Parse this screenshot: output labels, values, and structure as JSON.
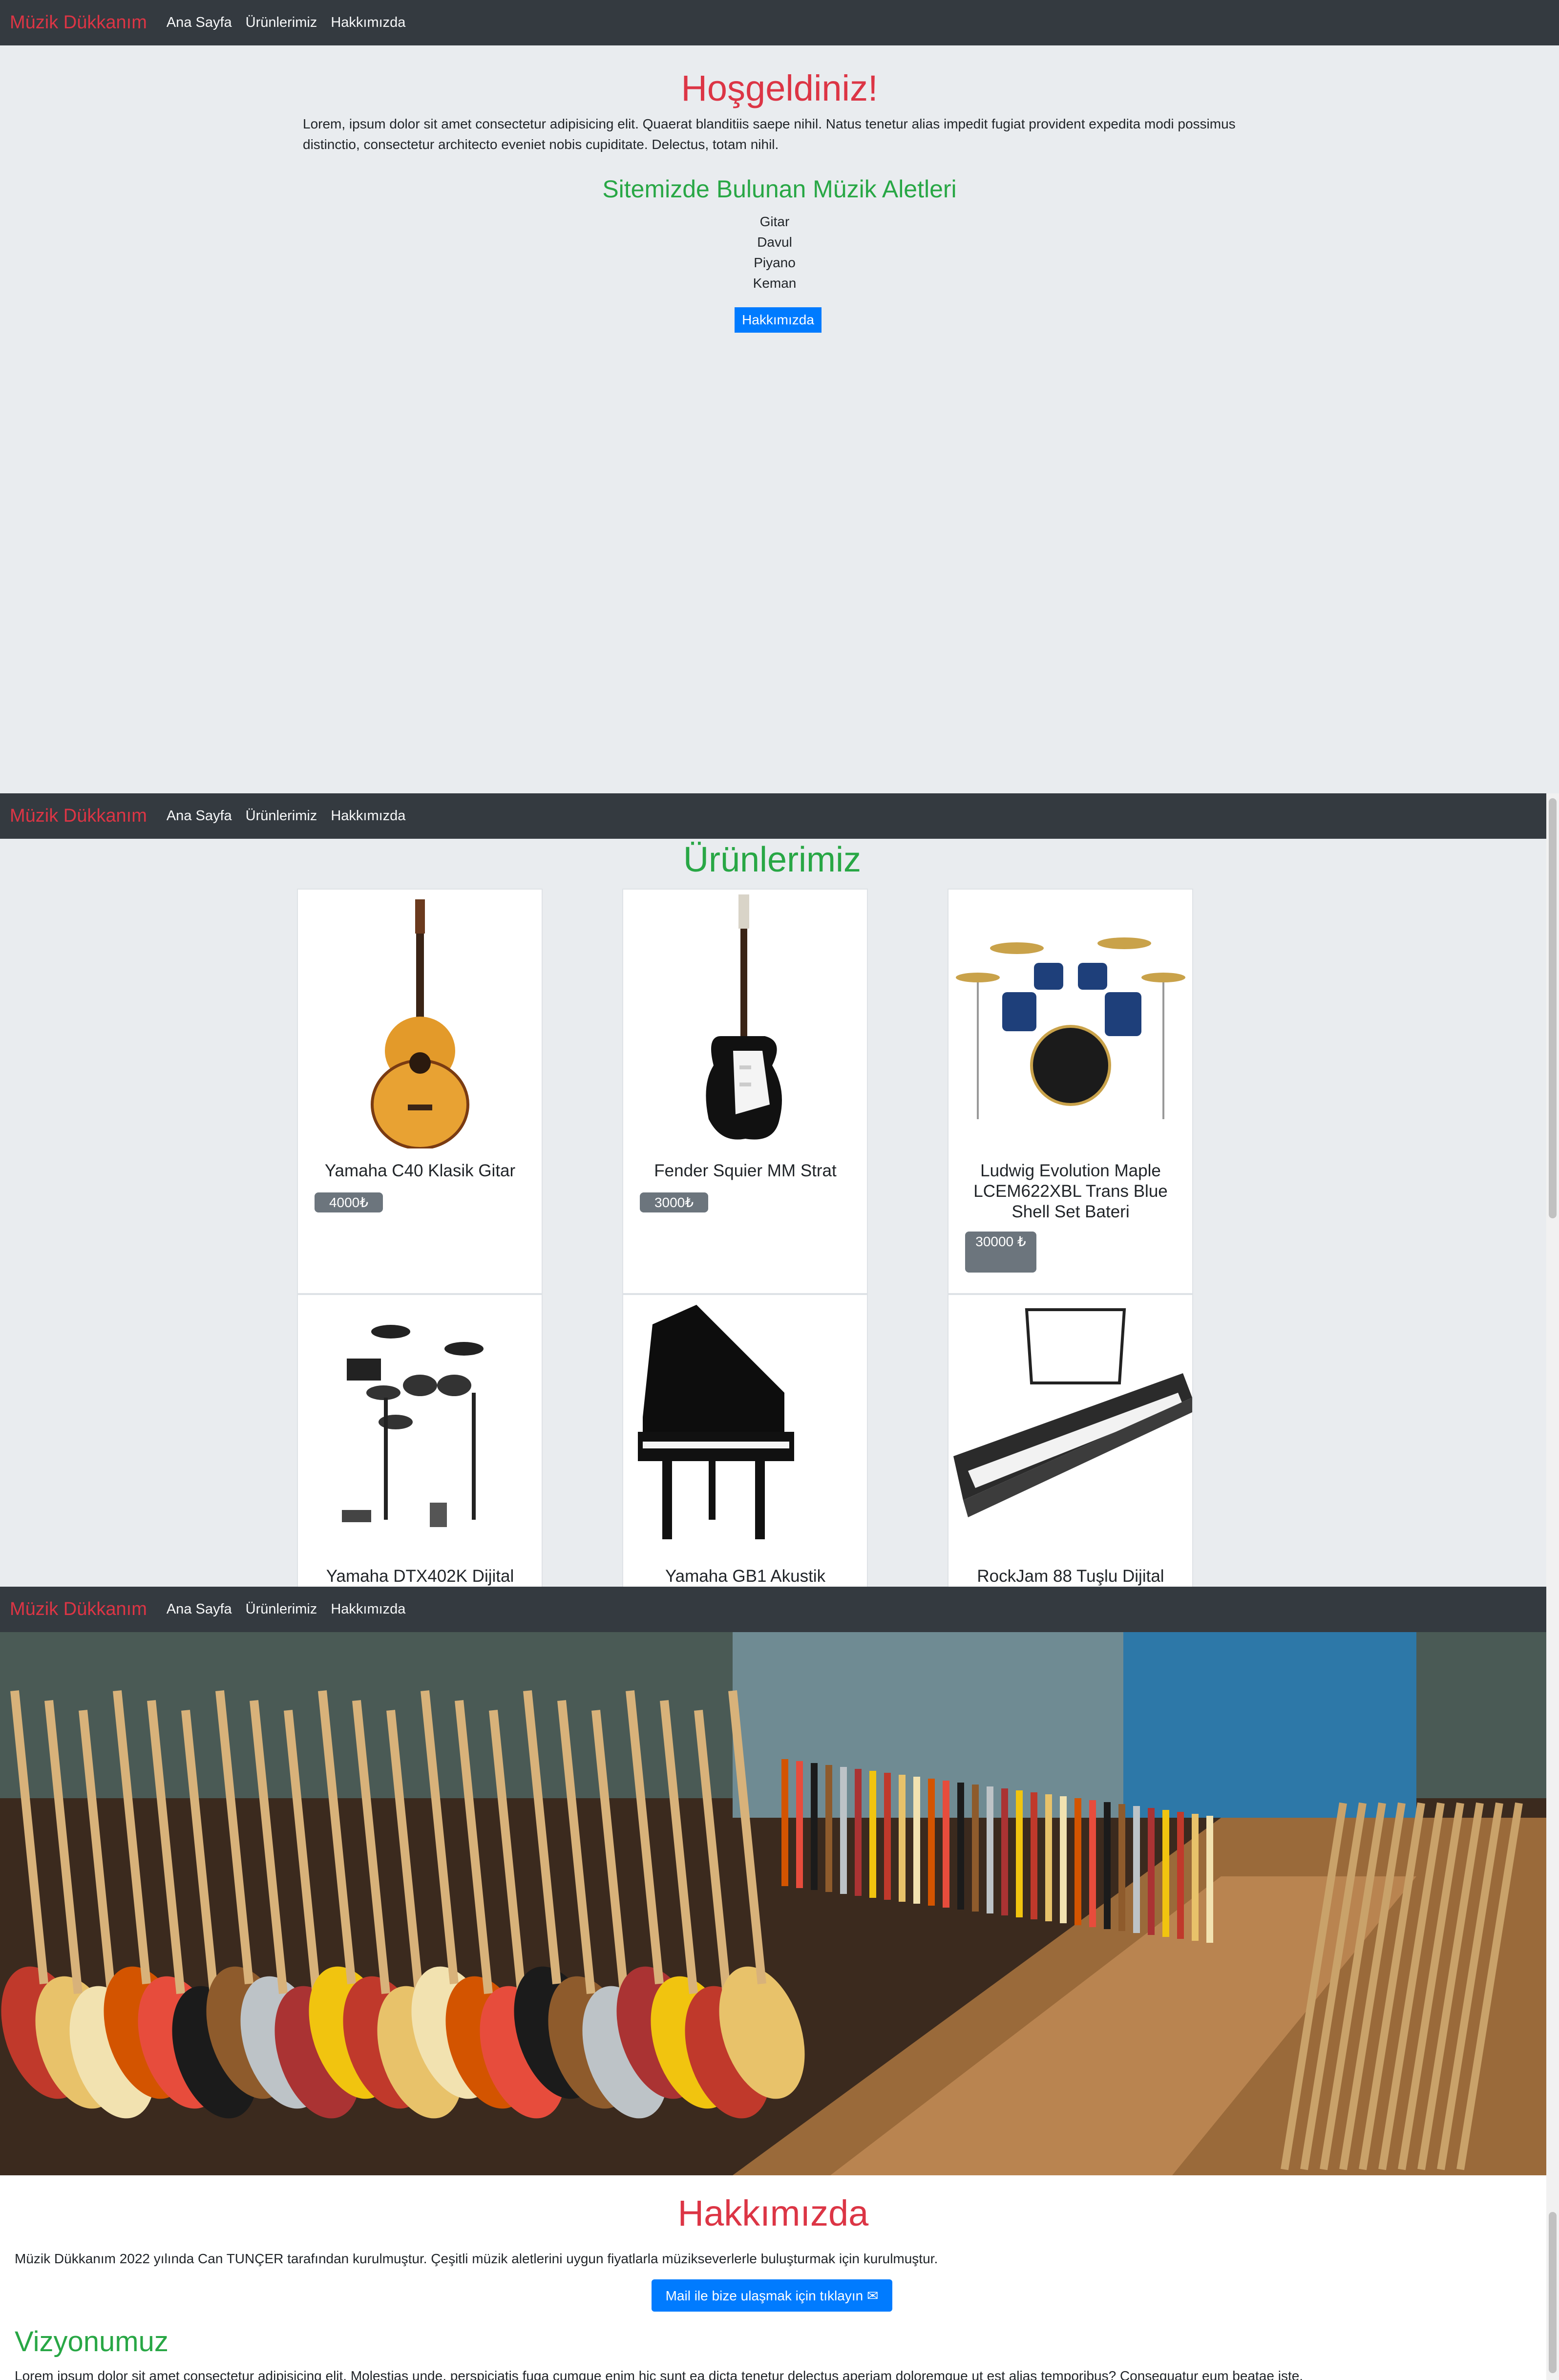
{
  "nav": {
    "brand": "Müzik Dükkanım",
    "links": [
      "Ana Sayfa",
      "Ürünlerimiz",
      "Hakkımızda"
    ]
  },
  "home": {
    "title": "Hoşgeldiniz!",
    "lead": "Lorem, ipsum dolor sit amet consectetur adipisicing elit. Quaerat blanditiis saepe nihil. Natus tenetur alias impedit fugiat provident expedita modi possimus distinctio, consectetur architecto eveniet nobis cupiditate. Delectus, totam nihil.",
    "subtitle": "Sitemizde Bulunan Müzik Aletleri",
    "instruments": [
      "Gitar",
      "Davul",
      "Piyano",
      "Keman"
    ],
    "button": "Hakkımızda"
  },
  "products": {
    "title": "Ürünlerimiz",
    "items": [
      {
        "name": "Yamaha C40 Klasik Gitar",
        "price": "4000₺",
        "image": "classical-guitar"
      },
      {
        "name": "Fender Squier MM Strat",
        "price": "3000₺",
        "image": "electric-guitar"
      },
      {
        "name": "Ludwig Evolution Maple LCEM622XBL Trans Blue Shell Set Bateri",
        "price": "30000 ₺",
        "image": "drum-kit"
      },
      {
        "name": "Yamaha DTX402K Dijital",
        "price": "",
        "image": "electronic-drum-kit"
      },
      {
        "name": "Yamaha GB1 Akustik",
        "price": "",
        "image": "grand-piano"
      },
      {
        "name": "RockJam 88 Tuşlu Dijital",
        "price": "",
        "image": "digital-piano"
      }
    ]
  },
  "about": {
    "title": "Hakkımızda",
    "text": "Müzik Dükkanım 2022 yılında Can TUNÇER tarafından kurulmuştur. Çeşitli müzik aletlerini uygun fiyatlarla müzikseverlerle buluşturmak için kurulmuştur.",
    "button": "Mail ile bize ulaşmak için tıklayın ✉",
    "vision_title": "Vizyonumuz",
    "vision_text": "Lorem ipsum dolor sit amet consectetur adipisicing elit. Molestias unde, perspiciatis fuga cumque enim hic sunt ea dicta tenetur delectus aperiam doloremque ut est alias temporibus? Consequatur eum beatae iste.",
    "hero_image": "guitar-store-photo"
  },
  "colors": {
    "navbar": "#343a40",
    "brand": "#dc3545",
    "heading_green": "#28a745",
    "primary_button": "#007bff",
    "badge": "#6c757d"
  }
}
